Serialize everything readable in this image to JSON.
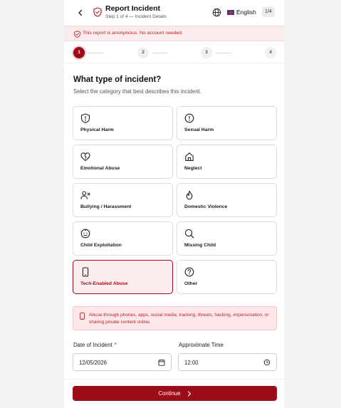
{
  "header": {
    "title": "Report Incident",
    "subtitle": "Step 1 of 4 — Incident Details",
    "language": "English",
    "page_counter": "1/4"
  },
  "banner": {
    "text": "This report is anonymous. No account needed."
  },
  "stepper": {
    "steps": [
      "1",
      "2",
      "3",
      "4"
    ],
    "current": 1
  },
  "question": {
    "title": "What type of incident?",
    "subtitle": "Select the category that best describes this incident."
  },
  "categories": [
    {
      "label": "Physical Harm",
      "icon": "shield-alert-icon",
      "selected": false
    },
    {
      "label": "Sexual Harm",
      "icon": "alert-circle-icon",
      "selected": false
    },
    {
      "label": "Emotional Abuse",
      "icon": "broken-heart-icon",
      "selected": false
    },
    {
      "label": "Neglect",
      "icon": "home-icon",
      "selected": false
    },
    {
      "label": "Bullying / Harassment",
      "icon": "user-x-icon",
      "selected": false
    },
    {
      "label": "Domestic Violence",
      "icon": "flame-icon",
      "selected": false
    },
    {
      "label": "Child Exploitation",
      "icon": "baby-face-icon",
      "selected": false
    },
    {
      "label": "Missing Child",
      "icon": "search-icon",
      "selected": false
    },
    {
      "label": "Tech-Enabled Abuse",
      "icon": "smartphone-icon",
      "selected": true
    },
    {
      "label": "Other",
      "icon": "help-circle-icon",
      "selected": false
    }
  ],
  "info": {
    "text": "Abuse through phones, apps, social media, tracking, threats, hacking, impersonation, or sharing private content online."
  },
  "date_field": {
    "label": "Date of Incident",
    "required_mark": "*",
    "value": "12/05/2026"
  },
  "time_field": {
    "label": "Approximate Time",
    "value": "12:00"
  },
  "continue": {
    "label": "Continue"
  },
  "colors": {
    "accent": "#9b0d19",
    "banner_bg": "#fcebec",
    "banner_text": "#b3232f"
  }
}
